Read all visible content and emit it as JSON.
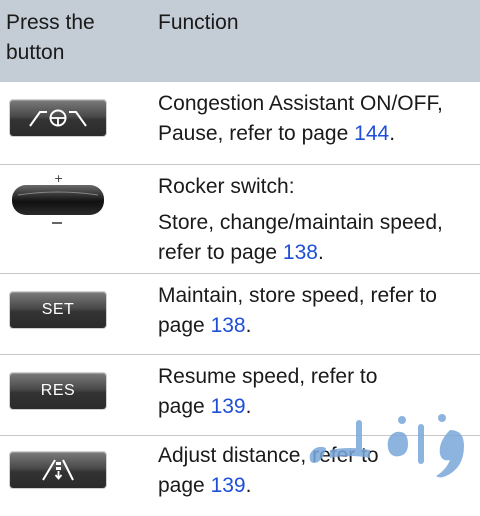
{
  "header": {
    "col_button": "Press the button",
    "col_function": "Function"
  },
  "rows": [
    {
      "button_icon": "congestion-assistant-icon",
      "text_before": "Congestion Assistant ON/OFF, Pause, refer to page ",
      "page": "144",
      "text_after": "."
    },
    {
      "button_icon": "rocker-switch-icon",
      "line1": "Rocker switch:",
      "text_before": "Store, change/maintain speed, refer to page ",
      "page": "138",
      "text_after": "."
    },
    {
      "button_label": "SET",
      "text_before": "Maintain, store speed, refer to page ",
      "page": "138",
      "text_after": "."
    },
    {
      "button_label": "RES",
      "text_before": "Resume speed, refer to page ",
      "page": "139",
      "text_after": "."
    },
    {
      "button_icon": "distance-adjust-icon",
      "text_before": "Adjust distance, refer to page ",
      "page": "139",
      "text_after": "."
    }
  ],
  "colors": {
    "header_bg": "#c4ccd5",
    "link": "#1e4fd6",
    "watermark": "#7aa7d9"
  },
  "watermark_icon": "watermark-logo"
}
